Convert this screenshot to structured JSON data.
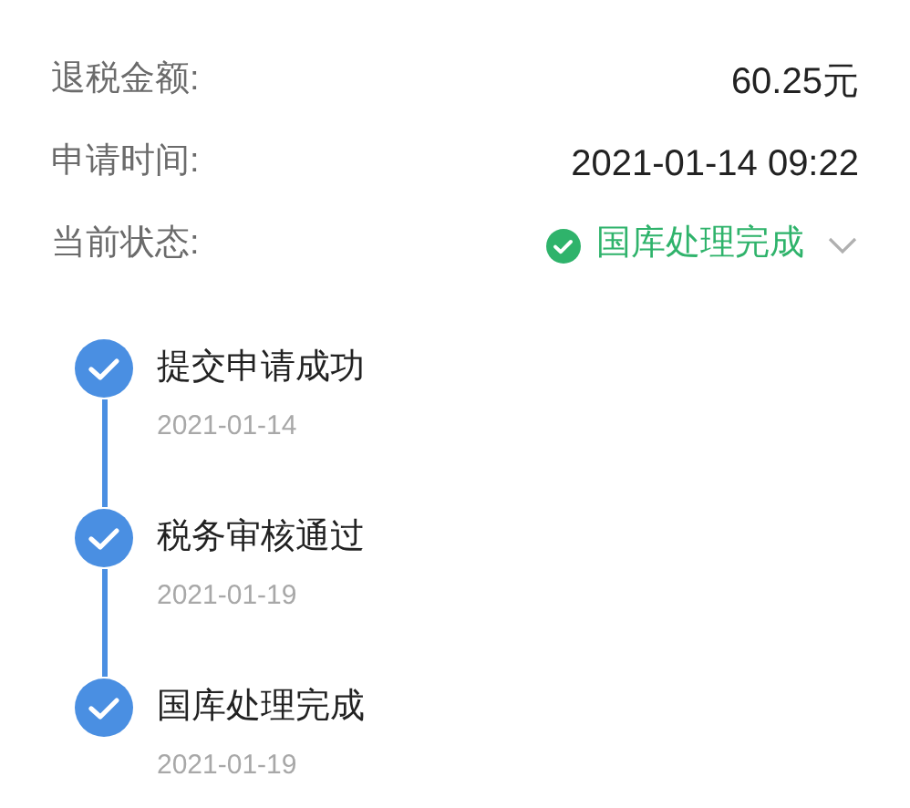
{
  "details": [
    {
      "kind": "text",
      "label": "退税金额:",
      "value": "60.25元"
    },
    {
      "kind": "text",
      "label": "申请时间:",
      "value": "2021-01-14 09:22"
    },
    {
      "kind": "status",
      "label": "当前状态:",
      "value": "国库处理完成"
    }
  ],
  "timeline": [
    {
      "title": "提交申请成功",
      "date": "2021-01-14",
      "done": true
    },
    {
      "title": "税务审核通过",
      "date": "2021-01-19",
      "done": true
    },
    {
      "title": "国库处理完成",
      "date": "2021-01-19",
      "done": true
    }
  ]
}
